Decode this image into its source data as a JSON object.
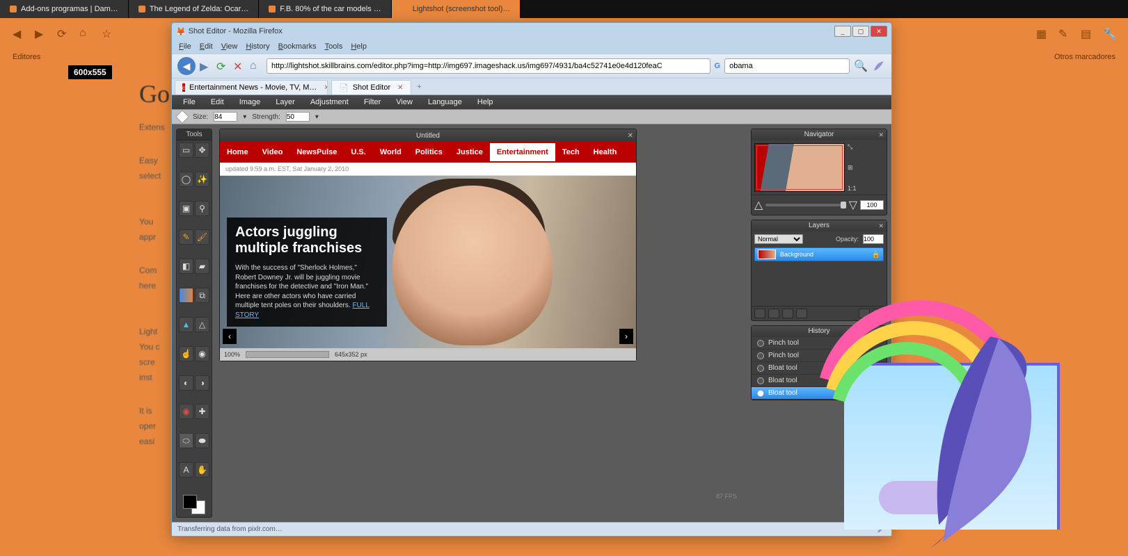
{
  "bg": {
    "tabs": [
      "Add-ons programas | Dam…",
      "The Legend of Zelda: Ocar…",
      "F.B. 80% of the car models …",
      "Lightshot (screenshot tool)…"
    ],
    "active_tab_index": 3,
    "bookmark_left": "Editores",
    "bookmark_right": "Otros marcadores",
    "selection_badge": "600x555",
    "content": {
      "logo": "Go",
      "heading": "Extens",
      "p1": "Easy",
      "p2": "select",
      "p3": "You",
      "p4": "appr",
      "p5": "Com",
      "p6": "here",
      "p7": "Light",
      "p8": "You c",
      "p9": "scre",
      "p10": "inst",
      "p11": "It is",
      "p12": "oper",
      "p13": "easi"
    }
  },
  "firefox": {
    "title": "Shot Editor - Mozilla Firefox",
    "menu": [
      "File",
      "Edit",
      "View",
      "History",
      "Bookmarks",
      "Tools",
      "Help"
    ],
    "url": "http://lightshot.skillbrains.com/editor.php?img=http://img697.imageshack.us/img697/4931/ba4c52741e0e4d120feaC",
    "search_value": "obama",
    "tabs": [
      {
        "label": "Entertainment News - Movie, TV, M…"
      },
      {
        "label": "Shot Editor"
      }
    ],
    "status": "Transferring data from pixlr.com…",
    "fps": "87 FPS"
  },
  "editor": {
    "menu": [
      "File",
      "Edit",
      "Image",
      "Layer",
      "Adjustment",
      "Filter",
      "View",
      "Language",
      "Help"
    ],
    "opt": {
      "size_label": "Size:",
      "size_value": "84",
      "strength_label": "Strength:",
      "strength_value": "50"
    },
    "tools_header": "Tools",
    "doc_title": "Untitled",
    "doc_status": {
      "zoom": "100%",
      "dims": "645x352 px"
    },
    "navigator": {
      "title": "Navigator",
      "zoom": "100"
    },
    "layers": {
      "title": "Layers",
      "mode": "Normal",
      "opacity_label": "Opacity:",
      "opacity": "100",
      "layer_name": "Background"
    },
    "history": {
      "title": "History",
      "items": [
        "Pinch tool",
        "Pinch tool",
        "Bloat tool",
        "Bloat tool",
        "Bloat tool"
      ],
      "active_index": 4
    }
  },
  "cnn": {
    "nav": [
      "Home",
      "Video",
      "NewsPulse",
      "U.S.",
      "World",
      "Politics",
      "Justice",
      "Entertainment",
      "Tech",
      "Health"
    ],
    "active_nav_index": 7,
    "timestamp": "updated 9:59 a.m. EST, Sat January 2, 2010",
    "headline": "Actors juggling multiple franchises",
    "blurb": "With the success of \"Sherlock Holmes,\" Robert Downey Jr. will be juggling movie franchises for the detective and \"Iron Man.\" Here are other actors who have carried multiple tent poles on their shoulders.",
    "full_story": "FULL STORY"
  }
}
